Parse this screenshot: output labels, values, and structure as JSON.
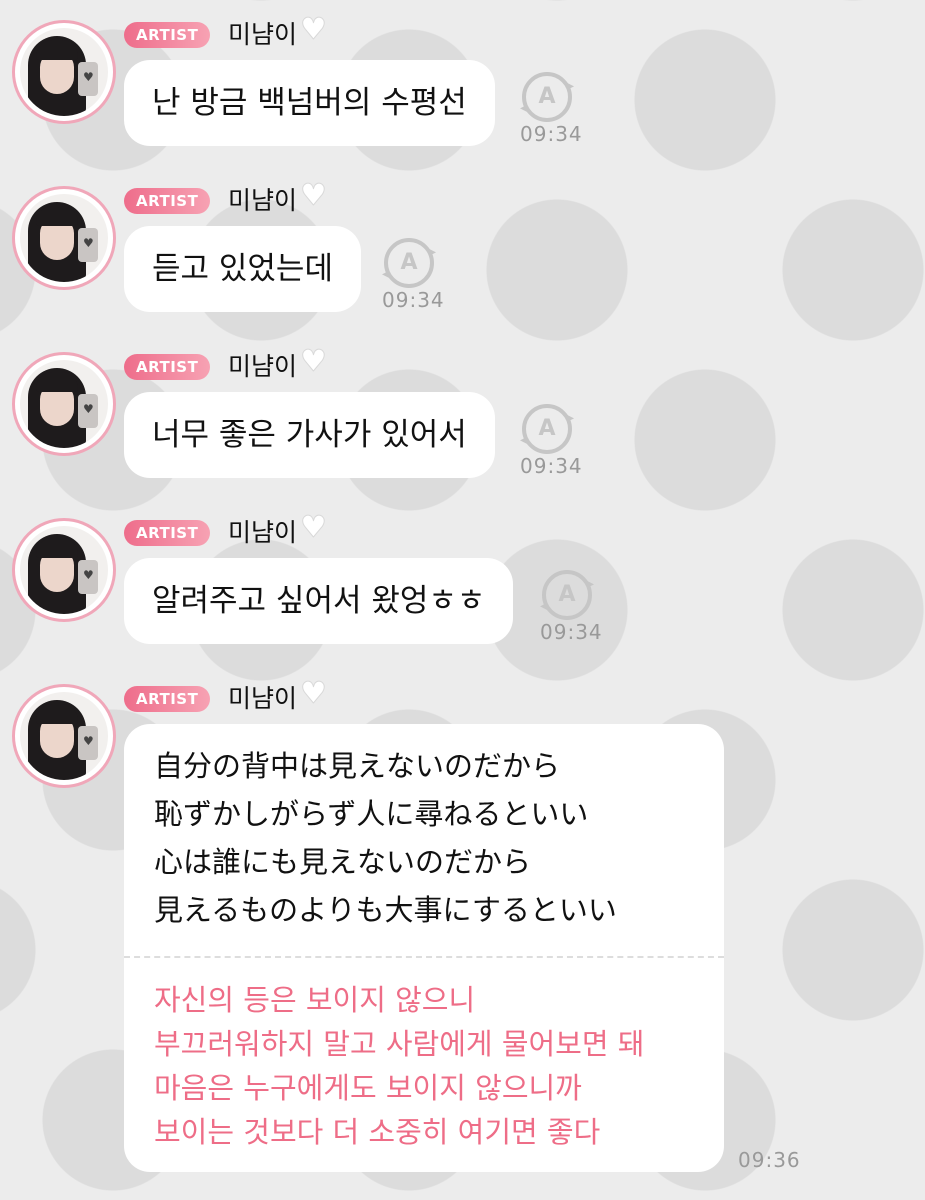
{
  "chat": {
    "artist_badge": "ARTIST",
    "sender_name": "미냠이",
    "heart_icon": "white-heart-icon",
    "translate_icon": "auto-translate-icon",
    "messages": [
      {
        "text": "난 방금 백넘버의 수평선",
        "time": "09:34"
      },
      {
        "text": "듣고 있었는데",
        "time": "09:34"
      },
      {
        "text": "너무 좋은 가사가 있어서",
        "time": "09:34"
      },
      {
        "text": "알려주고 싶어서 왔엉ㅎㅎ",
        "time": "09:34"
      }
    ],
    "lyrics": {
      "japanese": [
        "自分の背中は見えないのだから",
        "恥ずかしがらず人に尋ねるといい",
        "心は誰にも見えないのだから",
        "見えるものよりも大事にするといい"
      ],
      "korean": [
        "자신의 등은 보이지 않으니",
        "부끄러워하지 말고 사람에게 물어보면 돼",
        "마음은 누구에게도 보이지 않으니까",
        "보이는 것보다 더 소중히 여기면 좋다"
      ],
      "time": "09:36"
    }
  },
  "colors": {
    "background": "#ececec",
    "dot": "#dcdcdc",
    "badge_start": "#ee6d8b",
    "badge_end": "#f7a2b3",
    "translation_text": "#ee6d87",
    "timestamp": "#999999"
  }
}
